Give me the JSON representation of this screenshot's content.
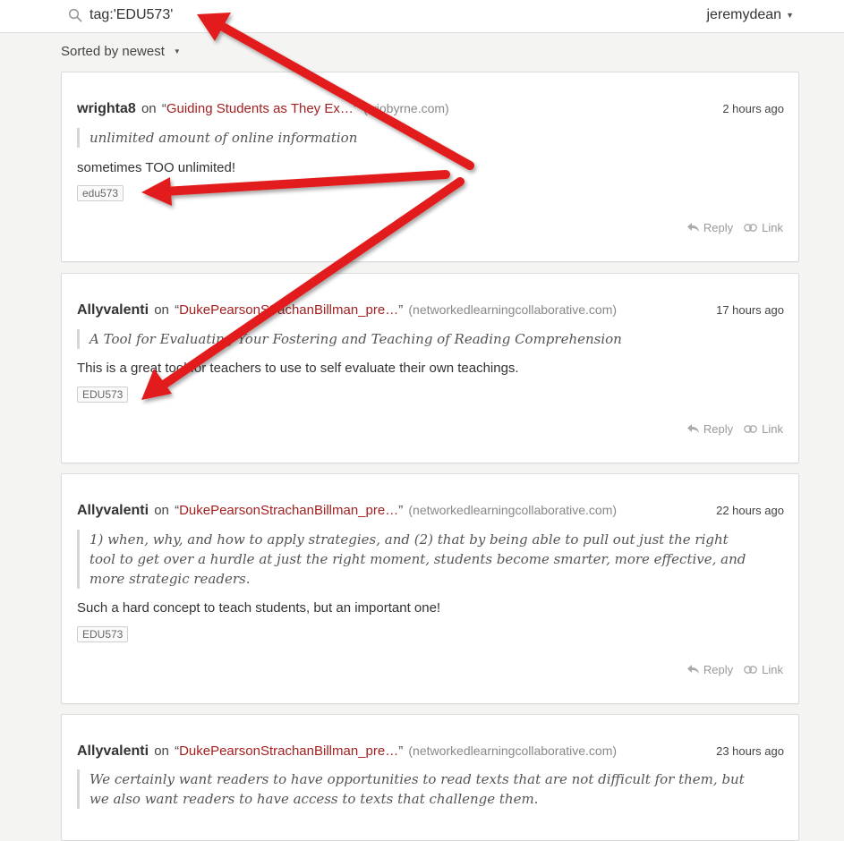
{
  "search": {
    "query": "tag:'EDU573'"
  },
  "user_menu": {
    "username": "jeremydean"
  },
  "sort": {
    "label": "Sorted by newest"
  },
  "annotations": [
    {
      "user": "wrighta8",
      "on": "on",
      "doc_title": "Guiding Students as They Ex…",
      "open_quote": "“",
      "close_quote": "”",
      "domain": "(wiobyrne.com)",
      "timestamp": "2 hours ago",
      "quote": "unlimited amount of online information",
      "comment": "sometimes TOO unlimited!",
      "tag": "edu573",
      "reply": "Reply",
      "link": "Link"
    },
    {
      "user": "Allyvalenti",
      "on": "on",
      "doc_title": "DukePearsonStrachanBillman_pre…",
      "open_quote": "“",
      "close_quote": "”",
      "domain": "(networkedlearningcollaborative.com)",
      "timestamp": "17 hours ago",
      "quote": "A Tool for Evaluating Your Fostering and Teaching of Reading Comprehension",
      "comment": "This is a great tool for teachers to use to self evaluate their own teachings.",
      "tag": "EDU573",
      "reply": "Reply",
      "link": "Link"
    },
    {
      "user": "Allyvalenti",
      "on": "on",
      "doc_title": "DukePearsonStrachanBillman_pre…",
      "open_quote": "“",
      "close_quote": "”",
      "domain": "(networkedlearningcollaborative.com)",
      "timestamp": "22 hours ago",
      "quote": "1) when, why, and how to apply strategies, and (2) that by being able to pull out just the right tool to get over a hurdle at just the right moment, students become smarter, more effective, and more strategic readers.",
      "comment": "Such a hard concept to teach students, but an important one!",
      "tag": "EDU573",
      "reply": "Reply",
      "link": "Link"
    },
    {
      "user": "Allyvalenti",
      "on": "on",
      "doc_title": "DukePearsonStrachanBillman_pre…",
      "open_quote": "“",
      "close_quote": "”",
      "domain": "(networkedlearningcollaborative.com)",
      "timestamp": "23 hours ago",
      "quote": "We certainly want readers to have opportunities to read texts that are not difficult for them, but we also want readers to have access to texts that challenge them."
    }
  ],
  "colors": {
    "doc_title": "#a32020",
    "arrow": "#e21b1b",
    "background": "#f4f4f3"
  },
  "icons": {
    "search": "search-icon",
    "reply": "reply-icon",
    "link": "link-icon",
    "caret": "caret-down-icon"
  }
}
